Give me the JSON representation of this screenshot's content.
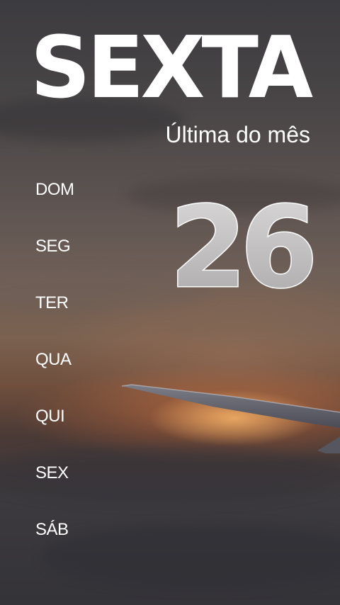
{
  "header": {
    "title": "SEXTA",
    "subtitle": "Última do mês"
  },
  "date": {
    "day_number": "26"
  },
  "weekdays": [
    {
      "label": "DOM"
    },
    {
      "label": "SEG"
    },
    {
      "label": "TER"
    },
    {
      "label": "QUA"
    },
    {
      "label": "QUI"
    },
    {
      "label": "SEX"
    },
    {
      "label": "SÁB"
    }
  ],
  "colors": {
    "text": "#ffffff",
    "number_fill": "#c8c6c6",
    "number_outline": "#ffffff"
  }
}
